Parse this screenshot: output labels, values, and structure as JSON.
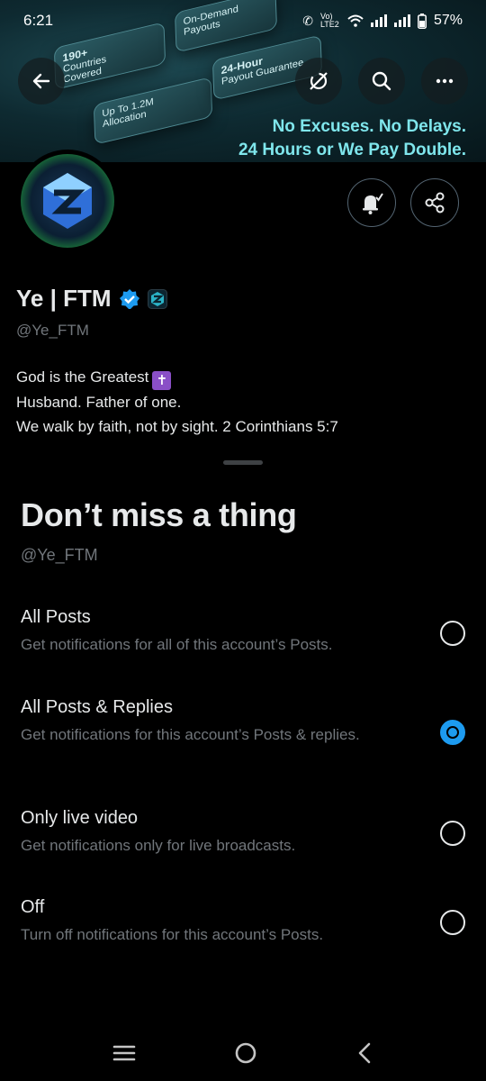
{
  "status_bar": {
    "time": "6:21",
    "network": "Vo) LTE2",
    "battery": "57%"
  },
  "banner": {
    "tiles": [
      {
        "big": "190+",
        "line1": "Countries",
        "line2": "Covered"
      },
      {
        "big": "",
        "line1": "On-Demand",
        "line2": "Payouts"
      },
      {
        "big": "",
        "line1": "Up To 1.2M",
        "line2": "Allocation"
      },
      {
        "big": "24-Hour",
        "line1": "Payout Guarantee",
        "line2": ""
      }
    ],
    "line1": "No Excuses. No Delays.",
    "line2": "24 Hours or We Pay Double."
  },
  "profile": {
    "name": "Ye | FTM",
    "handle": "@Ye_FTM",
    "bio": [
      "God is the Greatest",
      "Husband. Father of one.",
      "We walk by faith, not by sight. 2 Corinthians 5:7"
    ],
    "bio_emoji": "✝"
  },
  "sheet": {
    "title": "Don’t miss a thing",
    "handle": "@Ye_FTM",
    "options": [
      {
        "title": "All Posts",
        "desc": "Get notifications for all of this account’s Posts.",
        "selected": false
      },
      {
        "title": "All Posts & Replies",
        "desc": "Get notifications for this account’s Posts & replies.",
        "selected": true
      },
      {
        "title": "Only live video",
        "desc": "Get notifications only for live broadcasts.",
        "selected": false
      },
      {
        "title": "Off",
        "desc": "Turn off notifications for this account’s Posts.",
        "selected": false
      }
    ]
  },
  "colors": {
    "accent": "#1d9bf0",
    "muted": "#71767b",
    "text": "#e7e9ea",
    "banner_text": "#7fe6ec"
  },
  "icons": {
    "back": "back-arrow-icon",
    "sync": "sync-off-icon",
    "search": "search-icon",
    "more": "more-icon",
    "bell": "bell-check-icon",
    "share": "share-icon",
    "verified": "verified-badge-icon",
    "affiliate": "affiliate-logo-icon"
  }
}
